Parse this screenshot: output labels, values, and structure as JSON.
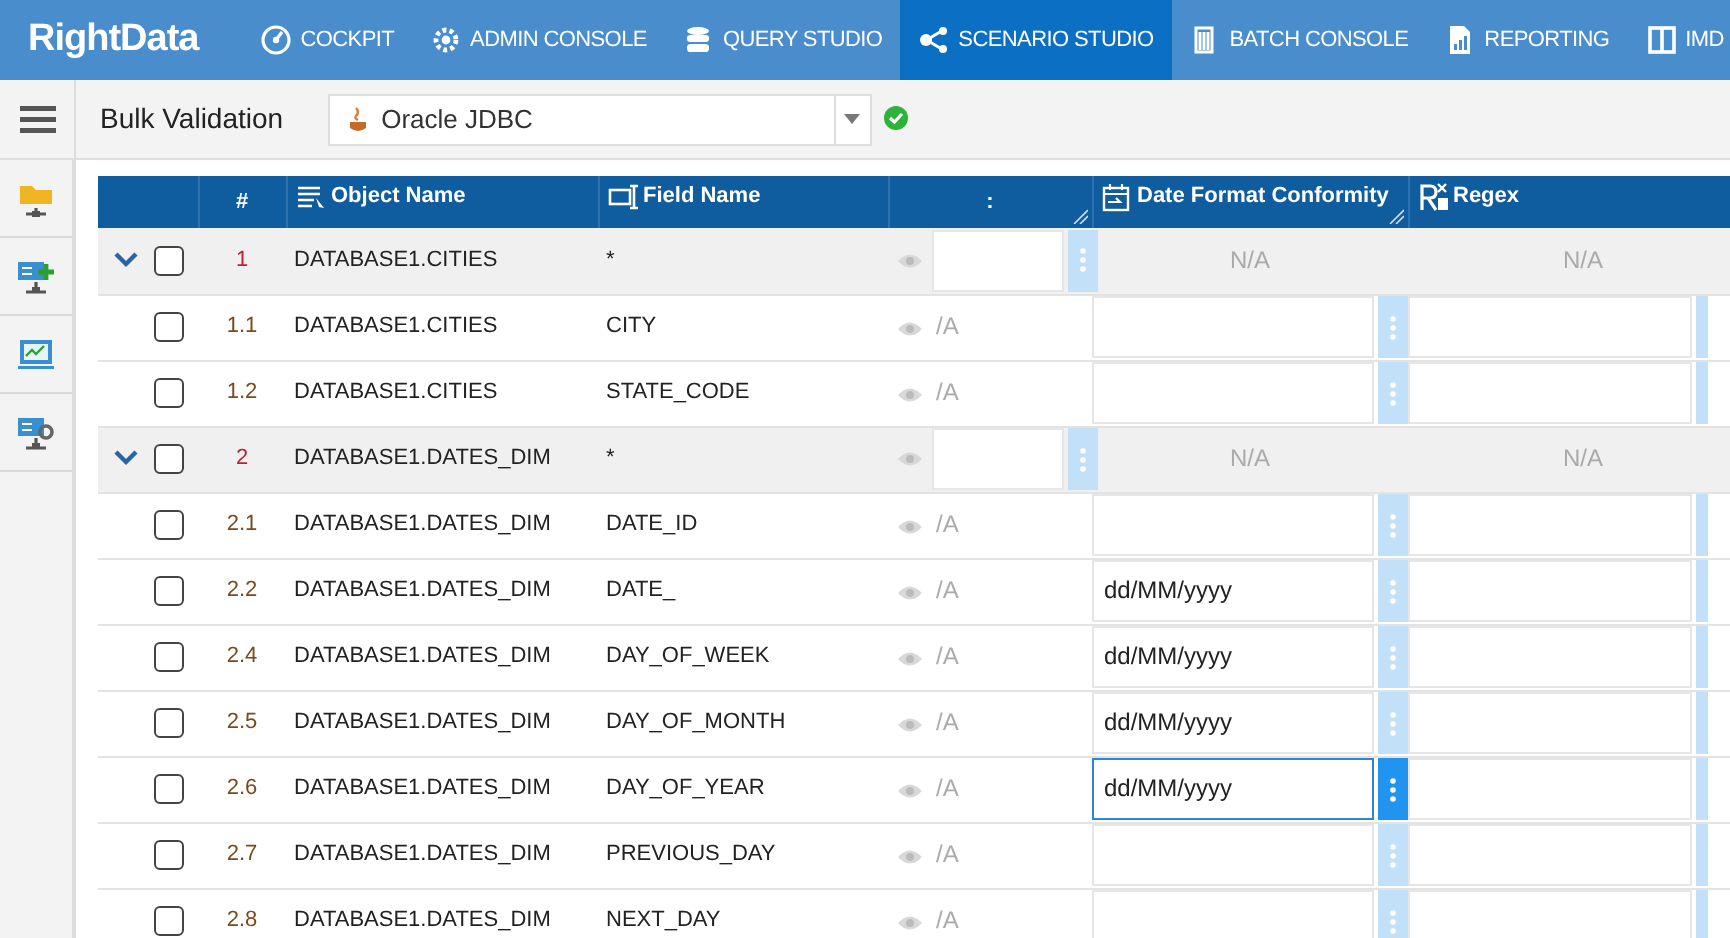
{
  "app": {
    "logo": "RightData"
  },
  "nav": [
    {
      "label": "COCKPIT",
      "selected": false
    },
    {
      "label": "ADMIN CONSOLE",
      "selected": false
    },
    {
      "label": "QUERY STUDIO",
      "selected": false
    },
    {
      "label": "SCENARIO STUDIO",
      "selected": true
    },
    {
      "label": "BATCH CONSOLE",
      "selected": false
    },
    {
      "label": "REPORTING",
      "selected": false
    },
    {
      "label": "IMD",
      "selected": false
    }
  ],
  "toolbar": {
    "title": "Bulk Validation",
    "connection": "Oracle JDBC",
    "connected": true
  },
  "table": {
    "columns": [
      "#",
      "Object Name",
      "Field Name",
      ":",
      "Date Format Conformity",
      "Regex"
    ],
    "rows": [
      {
        "kind": "group",
        "expanded": true,
        "checked": false,
        "num": "1",
        "object": "DATABASE1.CITIES",
        "field": "*",
        "date": "N/A",
        "regex": "N/A"
      },
      {
        "kind": "item",
        "checked": false,
        "num": "1.1",
        "object": "DATABASE1.CITIES",
        "field": "CITY",
        "mark": "/A",
        "date": "",
        "focused": false
      },
      {
        "kind": "item",
        "checked": false,
        "num": "1.2",
        "object": "DATABASE1.CITIES",
        "field": "STATE_CODE",
        "mark": "/A",
        "date": "",
        "focused": false
      },
      {
        "kind": "group",
        "expanded": true,
        "checked": false,
        "num": "2",
        "object": "DATABASE1.DATES_DIM",
        "field": "*",
        "date": "N/A",
        "regex": "N/A"
      },
      {
        "kind": "item",
        "checked": false,
        "num": "2.1",
        "object": "DATABASE1.DATES_DIM",
        "field": "DATE_ID",
        "mark": "/A",
        "date": "",
        "focused": false
      },
      {
        "kind": "item",
        "checked": false,
        "num": "2.2",
        "object": "DATABASE1.DATES_DIM",
        "field": "DATE_",
        "mark": "/A",
        "date": "dd/MM/yyyy",
        "focused": false
      },
      {
        "kind": "item",
        "checked": false,
        "num": "2.4",
        "object": "DATABASE1.DATES_DIM",
        "field": "DAY_OF_WEEK",
        "mark": "/A",
        "date": "dd/MM/yyyy",
        "focused": false
      },
      {
        "kind": "item",
        "checked": false,
        "num": "2.5",
        "object": "DATABASE1.DATES_DIM",
        "field": "DAY_OF_MONTH",
        "mark": "/A",
        "date": "dd/MM/yyyy",
        "focused": false
      },
      {
        "kind": "item",
        "checked": false,
        "num": "2.6",
        "object": "DATABASE1.DATES_DIM",
        "field": "DAY_OF_YEAR",
        "mark": "/A",
        "date": "dd/MM/yyyy",
        "focused": true
      },
      {
        "kind": "item",
        "checked": false,
        "num": "2.7",
        "object": "DATABASE1.DATES_DIM",
        "field": "PREVIOUS_DAY",
        "mark": "/A",
        "date": "",
        "focused": false
      },
      {
        "kind": "item",
        "checked": false,
        "num": "2.8",
        "object": "DATABASE1.DATES_DIM",
        "field": "NEXT_DAY",
        "mark": "/A",
        "date": "",
        "focused": false
      }
    ]
  }
}
